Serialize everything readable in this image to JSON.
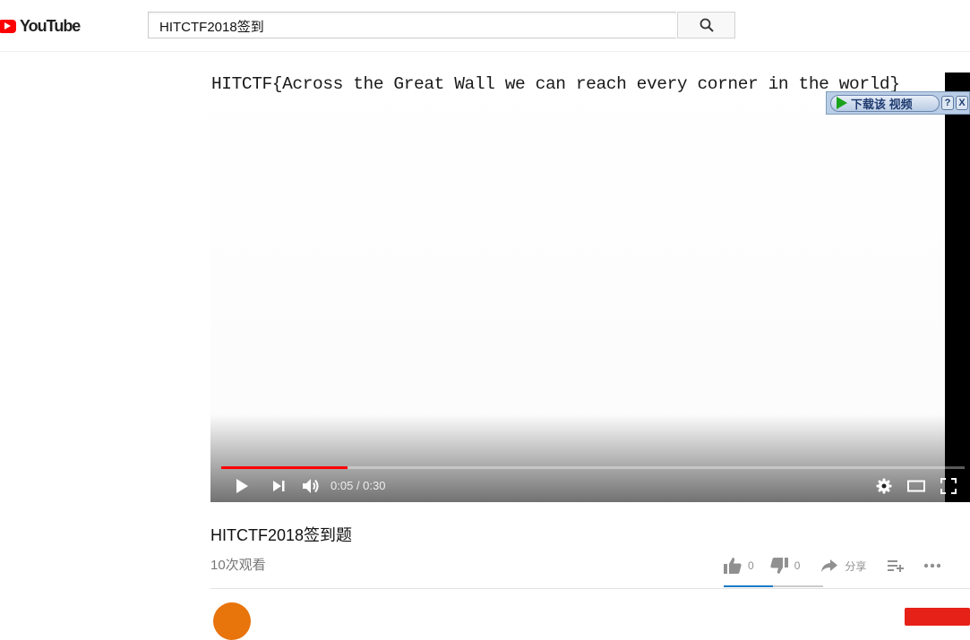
{
  "header": {
    "logo_text": "YouTube",
    "search_value": "HITCTF2018签到"
  },
  "player": {
    "video_text": "HITCTF{Across the Great Wall we can reach every corner in the world}",
    "download_label": "下载该 视频",
    "download_help": "?",
    "download_close": "X",
    "current_time": "0:05",
    "duration": "0:30",
    "time_display": "0:05 / 0:30",
    "progress_fraction": 0.17
  },
  "video": {
    "title": "HITCTF2018签到题",
    "views": "10次观看",
    "likes": "0",
    "dislikes": "0",
    "share_label": "分享"
  },
  "colors": {
    "brand_red": "#ff0000",
    "progress_red": "#ff0000",
    "sentiment_blue": "#167ac6"
  },
  "icons": [
    "play-icon",
    "next-icon",
    "volume-icon",
    "settings-gear-icon",
    "theater-mode-icon",
    "fullscreen-icon",
    "search-icon",
    "thumbs-up-icon",
    "thumbs-down-icon",
    "share-arrow-icon",
    "add-to-playlist-icon",
    "more-icon"
  ]
}
